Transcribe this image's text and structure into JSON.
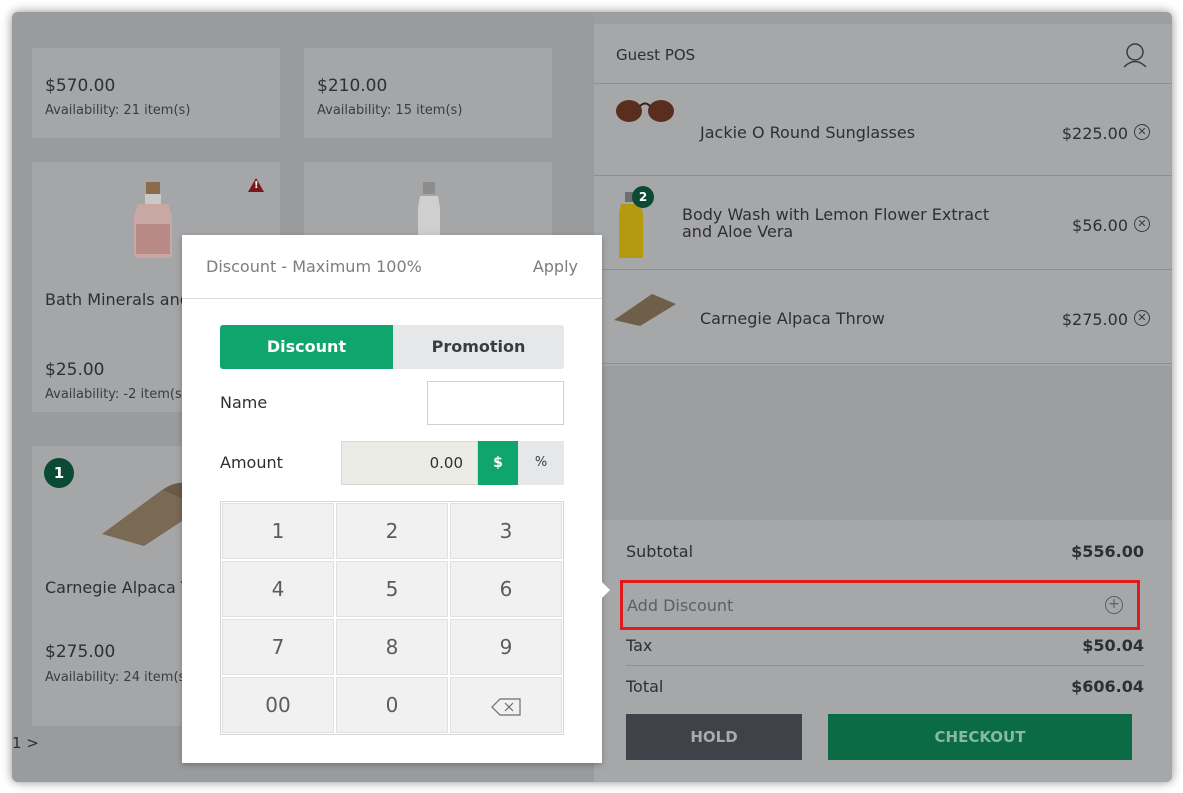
{
  "products": [
    {
      "price": "$570.00",
      "availability": "Availability: 21 item(s)"
    },
    {
      "price": "$210.00",
      "availability": "Availability: 15 item(s)"
    },
    {
      "name": "Bath Minerals and Salt",
      "price": "$25.00",
      "availability": "Availability: -2 item(s)",
      "warning": true
    },
    {
      "name": "Body Wash with Lemon Flower Extract",
      "price": "",
      "availability": ""
    },
    {
      "name": "Carnegie Alpaca Throw",
      "price": "$275.00",
      "availability": "Availability: 24 item(s)",
      "badge": "1"
    }
  ],
  "pager": {
    "label": "1 >"
  },
  "cart": {
    "title": "Guest POS",
    "items": [
      {
        "name": "Jackie O Round Sunglasses",
        "price": "$225.00"
      },
      {
        "name": "Body Wash with Lemon Flower Extract and Aloe Vera",
        "price": "$56.00",
        "badge": "2"
      },
      {
        "name": "Carnegie Alpaca Throw",
        "price": "$275.00"
      }
    ],
    "subtotal_label": "Subtotal",
    "subtotal_value": "$556.00",
    "add_discount_label": "Add Discount",
    "tax_label": "Tax",
    "tax_value": "$50.04",
    "total_label": "Total",
    "total_value": "$606.04",
    "hold_label": "HOLD",
    "checkout_label": "CHECKOUT"
  },
  "popup": {
    "title": "Discount - Maximum 100%",
    "apply_label": "Apply",
    "tabs": {
      "discount": "Discount",
      "promotion": "Promotion"
    },
    "name_label": "Name",
    "name_value": "",
    "amount_label": "Amount",
    "amount_value": "0.00",
    "unit_dollar": "$",
    "unit_percent": "%",
    "keys": [
      "1",
      "2",
      "3",
      "4",
      "5",
      "6",
      "7",
      "8",
      "9",
      "00",
      "0"
    ]
  },
  "colors": {
    "accent_green": "#11a56e",
    "checkout_green": "#0b6b44",
    "highlight_red": "#e01b1b",
    "hold_gray": "#3f4248"
  }
}
